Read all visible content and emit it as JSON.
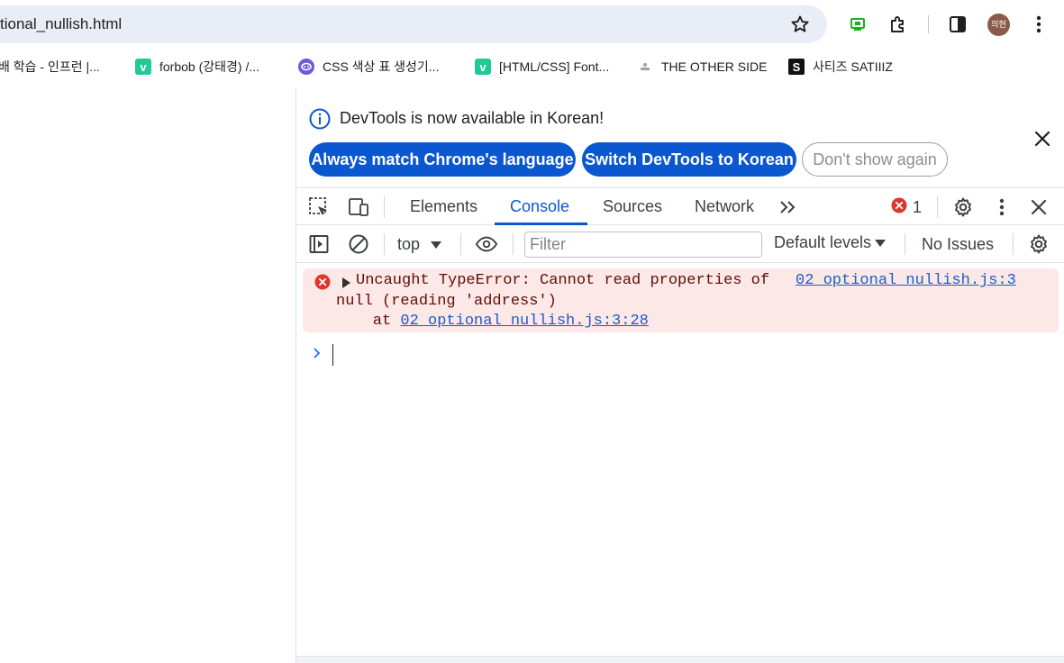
{
  "browser": {
    "address_bar": {
      "url_text": "tional_nullish.html"
    },
    "icons": [
      "star-icon",
      "cast-icon",
      "extensions-icon",
      "side-panel-icon",
      "profile-avatar",
      "kebab-menu-icon"
    ],
    "profile": {
      "avatar_text": "의현",
      "avatar_color": "#8a5a4a"
    }
  },
  "bookmarks": [
    {
      "label": "배 학습 - 인프런 |...",
      "icon": "inflearn-favicon"
    },
    {
      "label": "forbob (강태경) /...",
      "icon": "velog-favicon",
      "icon_text": "v",
      "color": "#20c997"
    },
    {
      "label": "CSS 색상 표 생성기...",
      "icon": "palette-favicon",
      "color": "#6e5bd8"
    },
    {
      "label": "[HTML/CSS] Font...",
      "icon": "velog-favicon",
      "icon_text": "v",
      "color": "#20c997"
    },
    {
      "label": "THE OTHER SIDE",
      "icon": "other-side-favicon"
    },
    {
      "label": "사티즈 SATIIIZ",
      "icon": "satiiiz-favicon",
      "icon_text": "S",
      "color": "#111111"
    }
  ],
  "devtools": {
    "infobar": {
      "message": "DevTools is now available in Korean!",
      "buttons": {
        "always_match": "Always match Chrome's language",
        "switch": "Switch DevTools to Korean",
        "dont_show": "Don't show again"
      }
    },
    "tabs": [
      {
        "label": "Elements",
        "active": false
      },
      {
        "label": "Console",
        "active": true
      },
      {
        "label": "Sources",
        "active": false
      },
      {
        "label": "Network",
        "active": false
      }
    ],
    "error_count": "1",
    "console_toolbar": {
      "context": "top",
      "filter_placeholder": "Filter",
      "levels": "Default levels",
      "issues": "No Issues"
    },
    "console": {
      "error": {
        "line1": "Uncaught TypeError: Cannot read properties of",
        "line2": "null (reading 'address')",
        "at_prefix": "    at ",
        "stack_link": "02_optional_nullish.js:3:28",
        "source_link": "02_optional_nullish.js:3"
      }
    },
    "colors": {
      "accent": "#0b57d0",
      "error_bg": "#fce8e6",
      "error_text": "#5f0e0b",
      "error_icon": "#dc362e",
      "link": "#1a5dc9"
    }
  }
}
